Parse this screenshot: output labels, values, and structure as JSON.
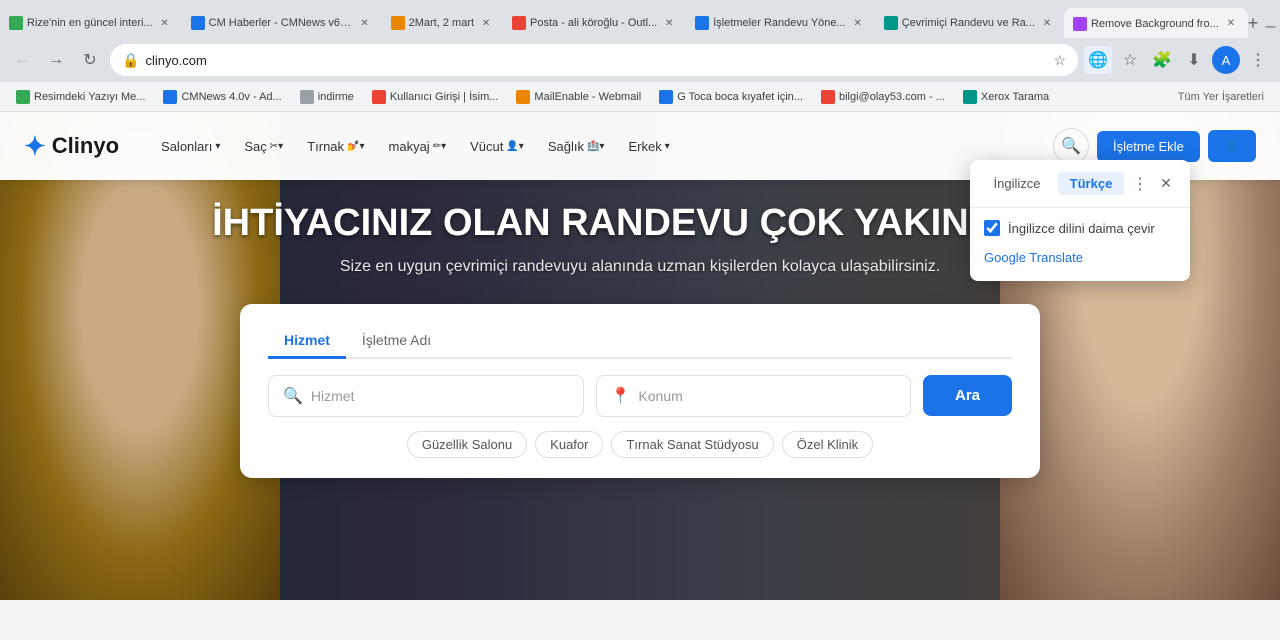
{
  "browser": {
    "tabs": [
      {
        "id": "tab1",
        "favicon_color": "green",
        "title": "Rize'nin en güncel interi...",
        "active": false
      },
      {
        "id": "tab2",
        "favicon_color": "blue",
        "title": "CM Haberler - CMNews v6 A...",
        "active": false
      },
      {
        "id": "tab3",
        "favicon_color": "orange",
        "title": "2Mart, 2 mart",
        "active": false
      },
      {
        "id": "tab4",
        "favicon_color": "red",
        "title": "Posta - ali köroğlu - Outl...",
        "active": false
      },
      {
        "id": "tab5",
        "favicon_color": "blue",
        "title": "İşletmeler Randevu Yöne...",
        "active": false
      },
      {
        "id": "tab6",
        "favicon_color": "teal",
        "title": "Çevrimiçi Randevu ve Ra...",
        "active": false
      },
      {
        "id": "tab7",
        "favicon_color": "purple",
        "title": "Remove Background fro...",
        "active": true
      }
    ],
    "url": "clinyo.com",
    "bookmarks": [
      {
        "favicon_color": "green",
        "label": "Resimdeki Yazıyı Me..."
      },
      {
        "favicon_color": "blue",
        "label": "CMNews 4.0v - Ad..."
      },
      {
        "favicon_color": "gray",
        "label": "indirme"
      },
      {
        "favicon_color": "red",
        "label": "Kullanıcı Girişi | İsim..."
      },
      {
        "favicon_color": "orange",
        "label": "MailEnable - Webmail"
      },
      {
        "favicon_color": "blue",
        "label": "G Toca boca kıyafet için..."
      },
      {
        "favicon_color": "red",
        "label": "bilgi@olay53.com - ..."
      },
      {
        "favicon_color": "teal",
        "label": "Xerox Tarama"
      }
    ],
    "bookmarks_more_label": "Tüm Yer İşaretleri"
  },
  "translate_popup": {
    "lang_from": "İngilizce",
    "lang_to": "Türkçe",
    "always_translate_label": "İngilizce dilini daima çevir",
    "google_translate_label": "Google Translate"
  },
  "website": {
    "logo_text": "Clinyo",
    "nav_links": [
      {
        "label": "Salonları",
        "has_arrow": true
      },
      {
        "label": "Saç",
        "has_arrow": true
      },
      {
        "label": "Tırnak",
        "has_arrow": true
      },
      {
        "label": "makyaj",
        "has_arrow": true
      },
      {
        "label": "Vücut",
        "has_arrow": true
      },
      {
        "label": "Sağlık",
        "has_arrow": true
      },
      {
        "label": "Erkek",
        "has_arrow": true
      }
    ],
    "hero_title": "İHTİYACINIZ OLAN RANDEVU ÇOK YAKINIZDA.",
    "hero_subtitle": "Size en uygun çevrimiçi randevuyu alanında uzman kişilerden kolayca ulaşabilirsiniz.",
    "search": {
      "tab_service": "Hizmet",
      "tab_business": "İşletme Adı",
      "field_service_placeholder": "Hizmet",
      "field_location_placeholder": "Konum",
      "search_btn_label": "Ara",
      "tags": [
        "Güzellik Salonu",
        "Kuafor",
        "Tırnak Sanat Stüdyosu",
        "Özel Klinik"
      ]
    }
  }
}
